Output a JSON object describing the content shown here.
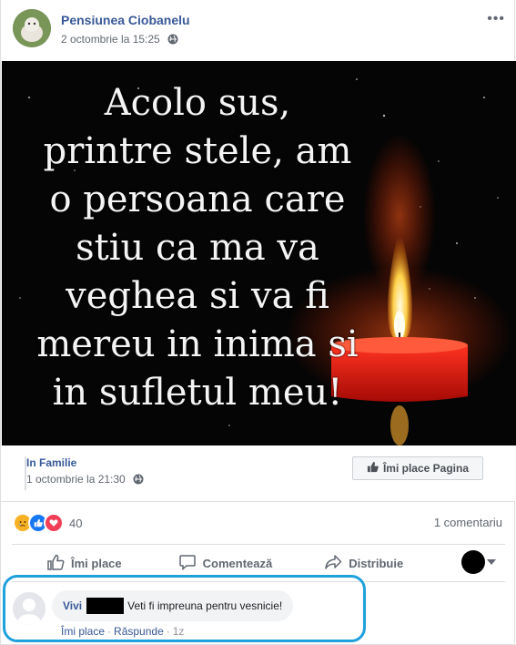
{
  "post": {
    "page_name": "Pensiunea Ciobanelu",
    "time": "2 octombrie la 15:25",
    "more_label": "•••"
  },
  "image": {
    "quote_lines": [
      "Acolo sus,",
      "printre stele, am",
      "o persoana care",
      "stiu ca ma va",
      "veghea si va fi",
      "mereu in inima si",
      "in sufletul meu!"
    ]
  },
  "shared": {
    "title": "In Familie",
    "time": "1 octombrie la 21:30",
    "like_page_label": "Îmi place Pagina"
  },
  "stats": {
    "reactions": [
      "sad",
      "like",
      "love"
    ],
    "reaction_count": "40",
    "comments": "1 comentariu"
  },
  "actions": {
    "like": "Îmi place",
    "comment": "Comentează",
    "share": "Distribuie"
  },
  "comment": {
    "author": "Vivi",
    "text": "Veti fi impreuna pentru vesnicie!",
    "like": "Îmi place",
    "reply": "Răspunde",
    "age": "1z"
  },
  "colors": {
    "link": "#385898",
    "highlight": "#1fa1dc"
  }
}
